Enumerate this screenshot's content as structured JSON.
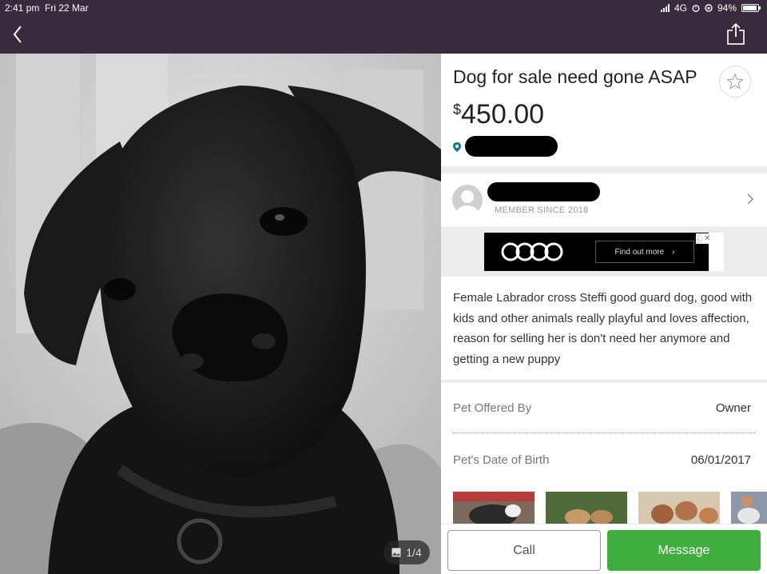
{
  "status_bar": {
    "time": "2:41 pm",
    "date": "Fri 22 Mar",
    "network": "4G",
    "battery": "94%",
    "battery_level": 0.94
  },
  "nav": {
    "back_icon": "chevron-left-icon",
    "share_icon": "share-icon"
  },
  "photo": {
    "counter": "1/4",
    "counter_icon": "image-icon"
  },
  "listing": {
    "title": "Dog for sale need gone ASAP",
    "price_currency": "$",
    "price_amount": "450.00",
    "favorite_icon": "star-icon",
    "location_icon": "location-pin-icon"
  },
  "seller": {
    "member_since": "MEMBER SINCE 2018"
  },
  "ad": {
    "cta": "Find out more"
  },
  "description": "Female Labrador cross Steffi good guard dog, good with kids and other animals really playful and loves affection, reason for selling her is don't need her anymore and getting a new puppy",
  "details": [
    {
      "label": "Pet Offered By",
      "value": "Owner"
    },
    {
      "label": "Pet's Date of Birth",
      "value": "06/01/2017"
    }
  ],
  "actions": {
    "call": "Call",
    "message": "Message"
  },
  "colors": {
    "nav_bar": "#3a2a3d",
    "message_button": "#3fae3f"
  }
}
